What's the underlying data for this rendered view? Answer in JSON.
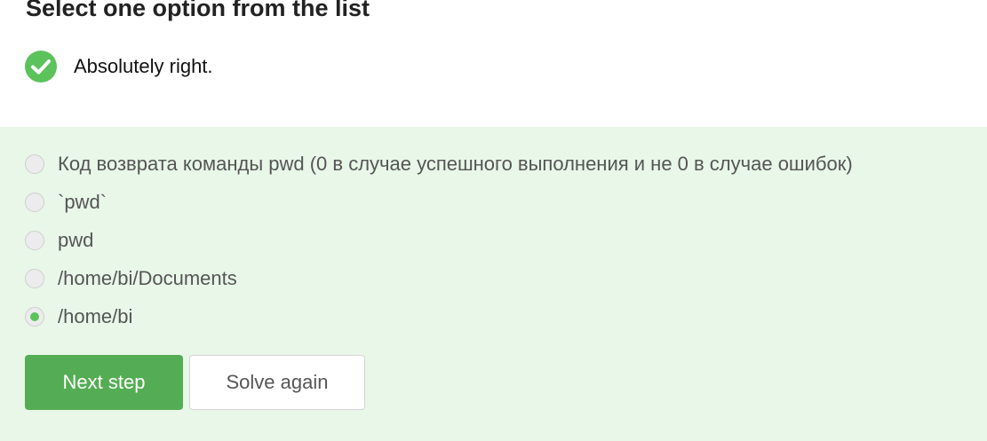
{
  "header": {
    "title": "Select one option from the list"
  },
  "feedback": {
    "icon": "check-circle-icon",
    "text": "Absolutely right.",
    "color": "#5cc25c"
  },
  "options": [
    {
      "label": "Код возврата команды pwd (0 в случае успешного выполнения и не 0 в случае ошибок)",
      "selected": false
    },
    {
      "label": "`pwd`",
      "selected": false
    },
    {
      "label": "pwd",
      "selected": false
    },
    {
      "label": "/home/bi/Documents",
      "selected": false
    },
    {
      "label": "/home/bi",
      "selected": true
    }
  ],
  "actions": {
    "next_label": "Next step",
    "solve_again_label": "Solve again"
  },
  "colors": {
    "accent": "#54ad54",
    "answer_background": "#e8f7e8"
  }
}
